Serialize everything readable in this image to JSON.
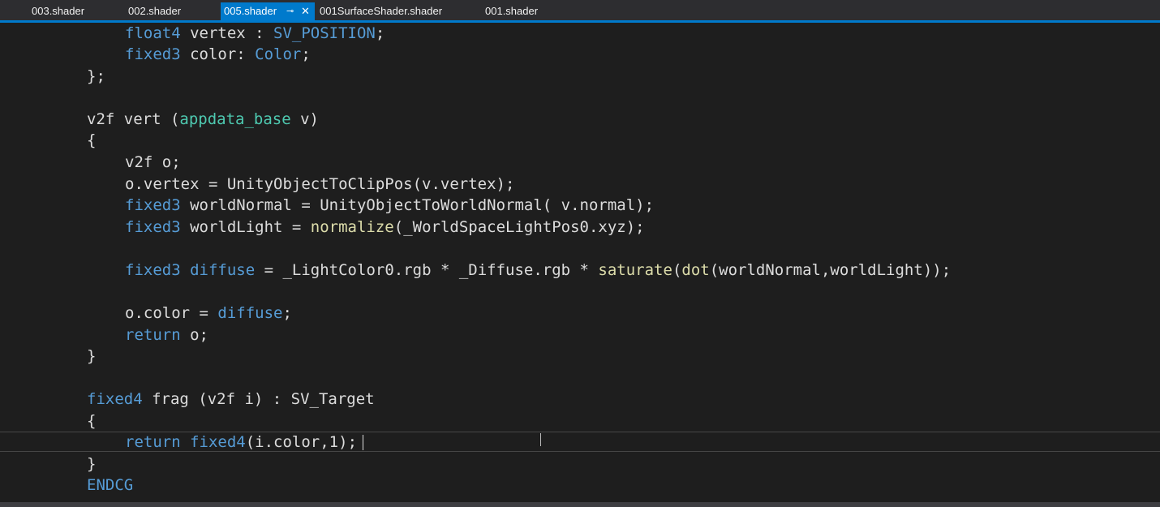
{
  "tabs": [
    {
      "label": "003.shader",
      "active": false
    },
    {
      "label": "002.shader",
      "active": false
    },
    {
      "label": "005.shader",
      "active": true
    },
    {
      "label": "001SurfaceShader.shader",
      "active": false
    },
    {
      "label": "001.shader",
      "active": false
    }
  ],
  "tab_icons": {
    "pin": "pin-icon",
    "close": "close-icon"
  },
  "code": {
    "l1": [
      "float4",
      " vertex : ",
      "SV_POSITION",
      ";"
    ],
    "l2": [
      "fixed3",
      " color",
      ": ",
      "Color",
      ";"
    ],
    "l3": [
      "};"
    ],
    "l5": [
      "v2f vert (",
      "appdata_base",
      " v)"
    ],
    "l6": [
      "{"
    ],
    "l7": [
      "v2f o;"
    ],
    "l8": [
      "o.vertex = UnityObjectToClipPos(v.vertex);"
    ],
    "l9": [
      "fixed3",
      " worldNormal = UnityObjectToWorldNormal( v.normal);"
    ],
    "l10": [
      "fixed3",
      " worldLight = ",
      "normalize",
      "(_WorldSpaceLightPos0.xyz);"
    ],
    "l12": [
      "fixed3",
      " ",
      "diffuse",
      " = _LightColor0.rgb * _Diffuse.rgb * ",
      "saturate",
      "(",
      "dot",
      "(worldNormal,worldLight));"
    ],
    "l14": [
      "o.color = ",
      "diffuse",
      ";"
    ],
    "l15": [
      "return",
      " o;"
    ],
    "l16": [
      "}"
    ],
    "l18": [
      "fixed4",
      " frag (v2f i) : SV_Target"
    ],
    "l19": [
      "{"
    ],
    "l20": [
      "return",
      " ",
      "fixed4",
      "(i.color,1);"
    ],
    "l21": [
      "}"
    ],
    "l22": [
      "ENDCG"
    ]
  },
  "colors": {
    "background": "#1e1e1e",
    "keyword": "#569cd6",
    "type": "#4ec9b0",
    "active_tab": "#007acc"
  }
}
